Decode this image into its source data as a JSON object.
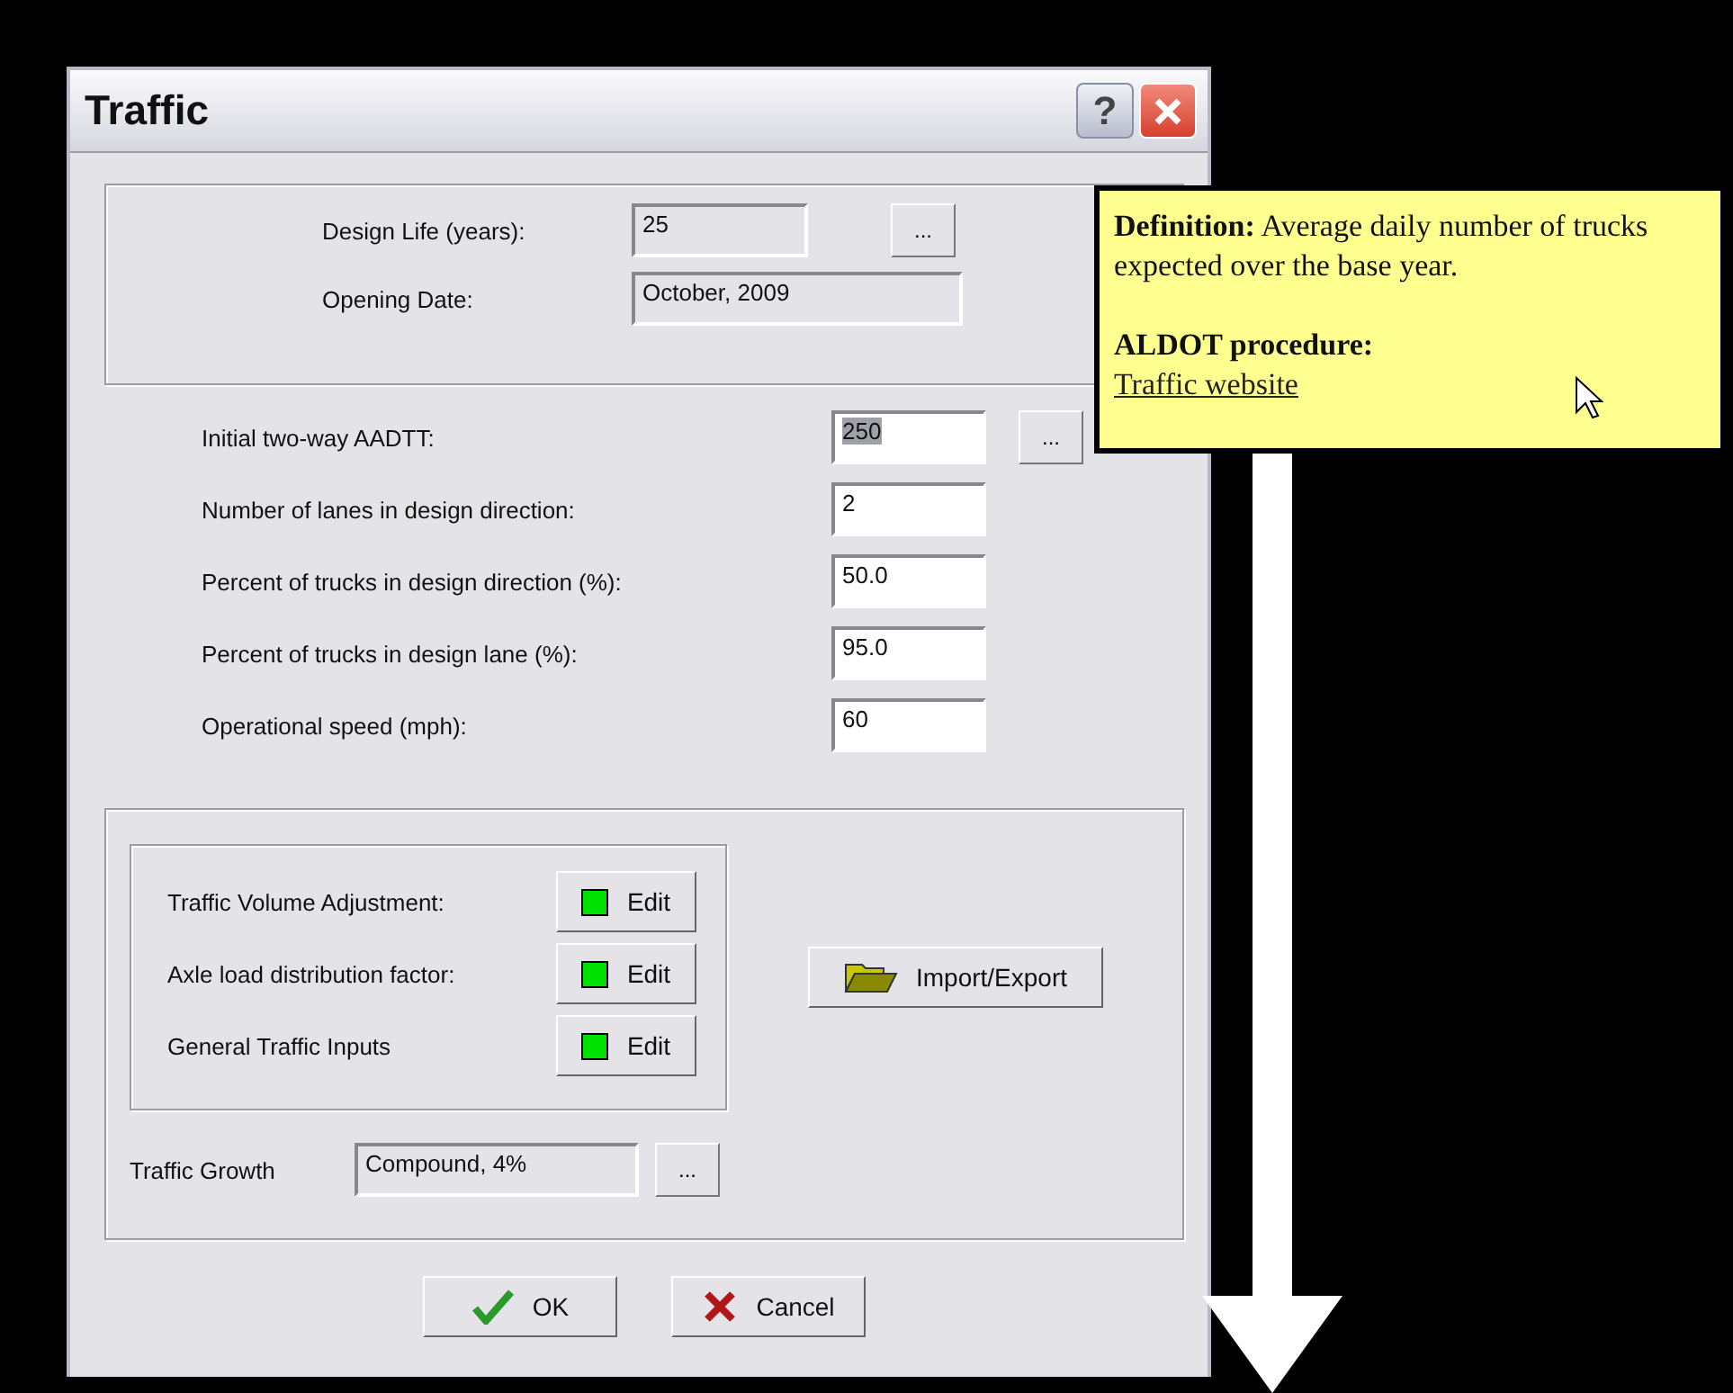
{
  "window": {
    "title": "Traffic",
    "help_button": "?"
  },
  "design_group": {
    "rows": [
      {
        "label": "Design Life (years):",
        "value": "25",
        "browse_label": "..."
      },
      {
        "label": "Opening Date:",
        "value": "October, 2009"
      }
    ]
  },
  "inputs": [
    {
      "label": "Initial two-way AADTT:",
      "value": "250",
      "selected": true,
      "browse_label": "..."
    },
    {
      "label": "Number of lanes in design direction:",
      "value": "2",
      "selected": false
    },
    {
      "label": "Percent of trucks in design direction (%):",
      "value": "50.0",
      "selected": false
    },
    {
      "label": "Percent of trucks in design lane (%):",
      "value": "95.0",
      "selected": false
    },
    {
      "label": "Operational speed (mph):",
      "value": "60",
      "selected": false
    }
  ],
  "edit_items": [
    {
      "label": "Traffic Volume Adjustment:",
      "button": "Edit",
      "color": "#00e000"
    },
    {
      "label": "Axle load distribution factor:",
      "button": "Edit",
      "color": "#00e000"
    },
    {
      "label": "General Traffic Inputs",
      "button": "Edit",
      "color": "#00e000"
    }
  ],
  "import_export": "Import/Export",
  "traffic_growth": {
    "label": "Traffic Growth",
    "value": "Compound, 4%",
    "browse_label": "..."
  },
  "buttons": [
    {
      "kind": "ok",
      "label": "OK"
    },
    {
      "kind": "cancel",
      "label": "Cancel"
    }
  ],
  "tooltip": {
    "definition": "**Definition:** Average daily number of trucks expected over the base year.",
    "procedure_heading": "ALDOT procedure:",
    "link": "Traffic website"
  }
}
